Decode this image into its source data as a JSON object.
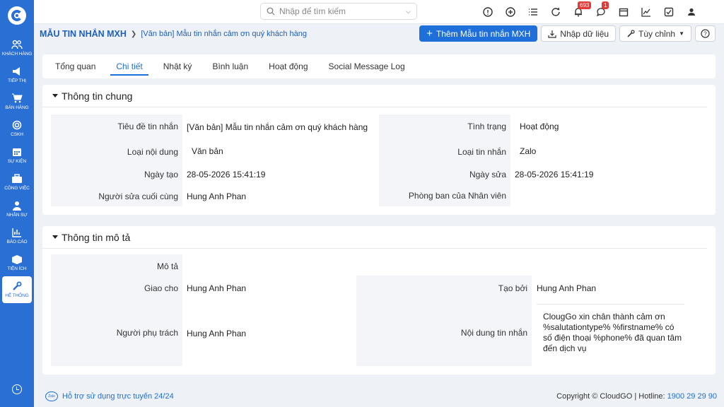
{
  "sidebar": {
    "items": [
      {
        "label": "Khách hàng",
        "icon": "users-icon"
      },
      {
        "label": "Tiếp thị",
        "icon": "megaphone-icon"
      },
      {
        "label": "Bán hàng",
        "icon": "cart-icon"
      },
      {
        "label": "CSKH",
        "icon": "lifebuoy-icon"
      },
      {
        "label": "Sự kiện",
        "icon": "calendar-icon"
      },
      {
        "label": "Công việc",
        "icon": "briefcase-icon"
      },
      {
        "label": "Nhân sự",
        "icon": "person-icon"
      },
      {
        "label": "Báo cáo",
        "icon": "report-icon"
      },
      {
        "label": "Tiện ích",
        "icon": "box-icon"
      },
      {
        "label": "Hệ thống",
        "icon": "wrench-icon"
      }
    ],
    "active_index": 9
  },
  "topbar": {
    "search_placeholder": "Nhập để tìm kiếm",
    "notif_count": "693",
    "chat_count": "1"
  },
  "header": {
    "module_title": "MẪU TIN NHẮN MXH",
    "record_title": "[Văn bản] Mẫu tin nhắn cảm ơn quý khách hàng",
    "add_button": "Thêm Mẫu tin nhắn MXH",
    "import_button": "Nhập dữ liệu",
    "customize_button": "Tùy chỉnh"
  },
  "tabs": [
    "Tổng quan",
    "Chi tiết",
    "Nhật ký",
    "Bình luận",
    "Hoạt động",
    "Social Message Log"
  ],
  "general": {
    "title": "Thông tin chung",
    "subject_label": "Tiêu đề tin nhắn",
    "subject_value": "[Văn bản] Mẫu tin nhắn cảm ơn quý khách hàng",
    "status_label": "Tình trạng",
    "status_value": "Hoạt động",
    "content_type_label": "Loại nội dung",
    "content_type_value": "Văn bản",
    "msg_type_label": "Loại tin nhắn",
    "msg_type_value": "Zalo",
    "created_label": "Ngày tạo",
    "created_value": "28-05-2026 15:41:19",
    "modified_label": "Ngày sửa",
    "modified_value": "28-05-2026 15:41:19",
    "last_modified_by_label": "Người sửa cuối cùng",
    "last_modified_by_value": "Hung Anh Phan",
    "department_label": "Phòng ban của Nhân viên",
    "department_value": ""
  },
  "description": {
    "title": "Thông tin mô tả",
    "desc_label": "Mô tả",
    "desc_value": "",
    "assigned_label": "Giao cho",
    "assigned_value": "Hung Anh Phan",
    "created_by_label": "Tạo bởi",
    "created_by_value": "Hung Anh Phan",
    "owner_label": "Người phụ trách",
    "owner_value": "Hung Anh Phan",
    "content_label": "Nội dung tin nhắn",
    "content_value": "ClougGo xin chân thành cảm ơn %salutationtype% %firstname% có số điện thoại %phone% đã quan tâm đến dịch vụ"
  },
  "footer": {
    "help_text": "Hỗ trợ sử dụng trực tuyến 24/24",
    "copyright": "Copyright © CloudGO",
    "hotline_label": "Hotline:",
    "hotline_number": "1900 29 29 90"
  },
  "colors": {
    "brand": "#2a6fd4",
    "accent": "#1e6fd9",
    "badge": "#e53935"
  }
}
